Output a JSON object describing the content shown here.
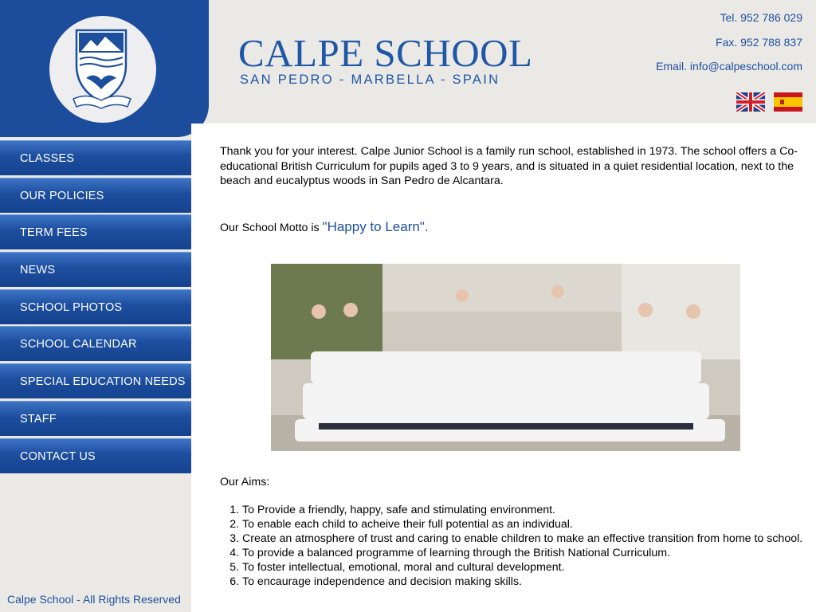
{
  "colors": {
    "brand_blue": "#1b4d9c",
    "text_blue": "#1c4f9e",
    "background": "#efeeec"
  },
  "header": {
    "school_name": "CALPE SCHOOL",
    "location": "SAN PEDRO - MARBELLA - SPAIN",
    "tel": "Tel. 952 786 029",
    "fax": "Fax. 952 788 837",
    "email": "Email. info@calpeschool.com",
    "languages": [
      {
        "icon": "uk-flag-icon"
      },
      {
        "icon": "spain-flag-icon"
      }
    ]
  },
  "sidebar": {
    "logo_icon": "school-crest-icon",
    "nav": [
      {
        "label": "CLASSES"
      },
      {
        "label": "OUR POLICIES"
      },
      {
        "label": "TERM FEES"
      },
      {
        "label": "NEWS"
      },
      {
        "label": "SCHOOL PHOTOS"
      },
      {
        "label": "SCHOOL CALENDAR"
      },
      {
        "label": "SPECIAL EDUCATION NEEDS"
      },
      {
        "label": "STAFF"
      },
      {
        "label": "CONTACT US"
      }
    ],
    "footer": "Calpe School - All Rights Reserved"
  },
  "main": {
    "intro": "Thank you for your interest. Calpe Junior School is a family run school, established in 1973. The school offers a Co-educational British Curriculum for pupils aged 3 to 9 years, and is situated in a quiet residential location, next to the beach and eucalyptus woods in San Pedro de Alcantara.",
    "motto_prefix": "Our School Motto is ",
    "motto": "\"Happy to Learn\".",
    "aims_label": "Our Aims:",
    "aims": [
      "To Provide a friendly, happy, safe and stimulating environment.",
      "To enable each child to acheive their full potential as an individual.",
      "Create an atmosphere of trust and caring to enable children to make an effective transition from home to school.",
      "To provide a balanced programme of learning through the British National Curriculum.",
      "To foster intellectual, emotional, moral and cultural development.",
      "To encaurage independence and decision making skills."
    ]
  }
}
